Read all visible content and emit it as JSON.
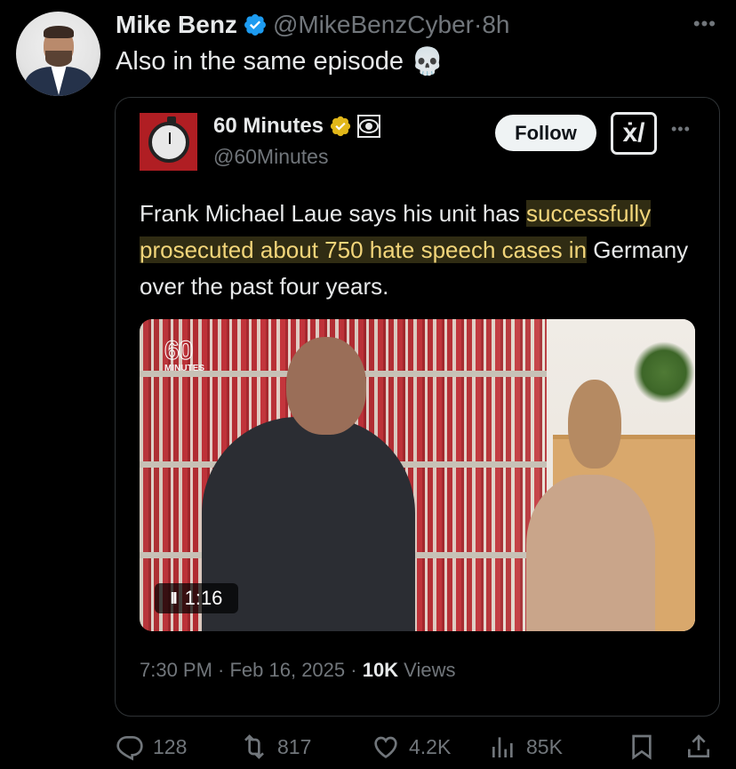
{
  "tweet": {
    "author_name": "Mike Benz",
    "author_handle": "@MikeBenzCyber",
    "separator": "·",
    "time": "8h",
    "text": "Also in the same episode",
    "emoji": "💀"
  },
  "quote": {
    "author_name": "60 Minutes",
    "author_handle": "@60Minutes",
    "follow_label": "Follow",
    "grok_label": "ẋ/",
    "text_before": "Frank Michael Laue says his unit has ",
    "text_highlight": "successfully prosecuted about 750 hate speech cases in",
    "text_after": " Germany over the past four years.",
    "video": {
      "logo_number": "60",
      "logo_sub": "MINUTES",
      "pause_glyph": "II",
      "duration": "1:16"
    },
    "meta_time": "7:30 PM · Feb 16, 2025 · ",
    "meta_views": "10K",
    "meta_views_label": " Views"
  },
  "actions": {
    "replies": "128",
    "reposts": "817",
    "likes": "4.2K",
    "views": "85K"
  },
  "colors": {
    "background": "#000000",
    "verified_blue": "#1d9bf0",
    "verified_gold": "#e2b719",
    "muted": "#71767b"
  }
}
